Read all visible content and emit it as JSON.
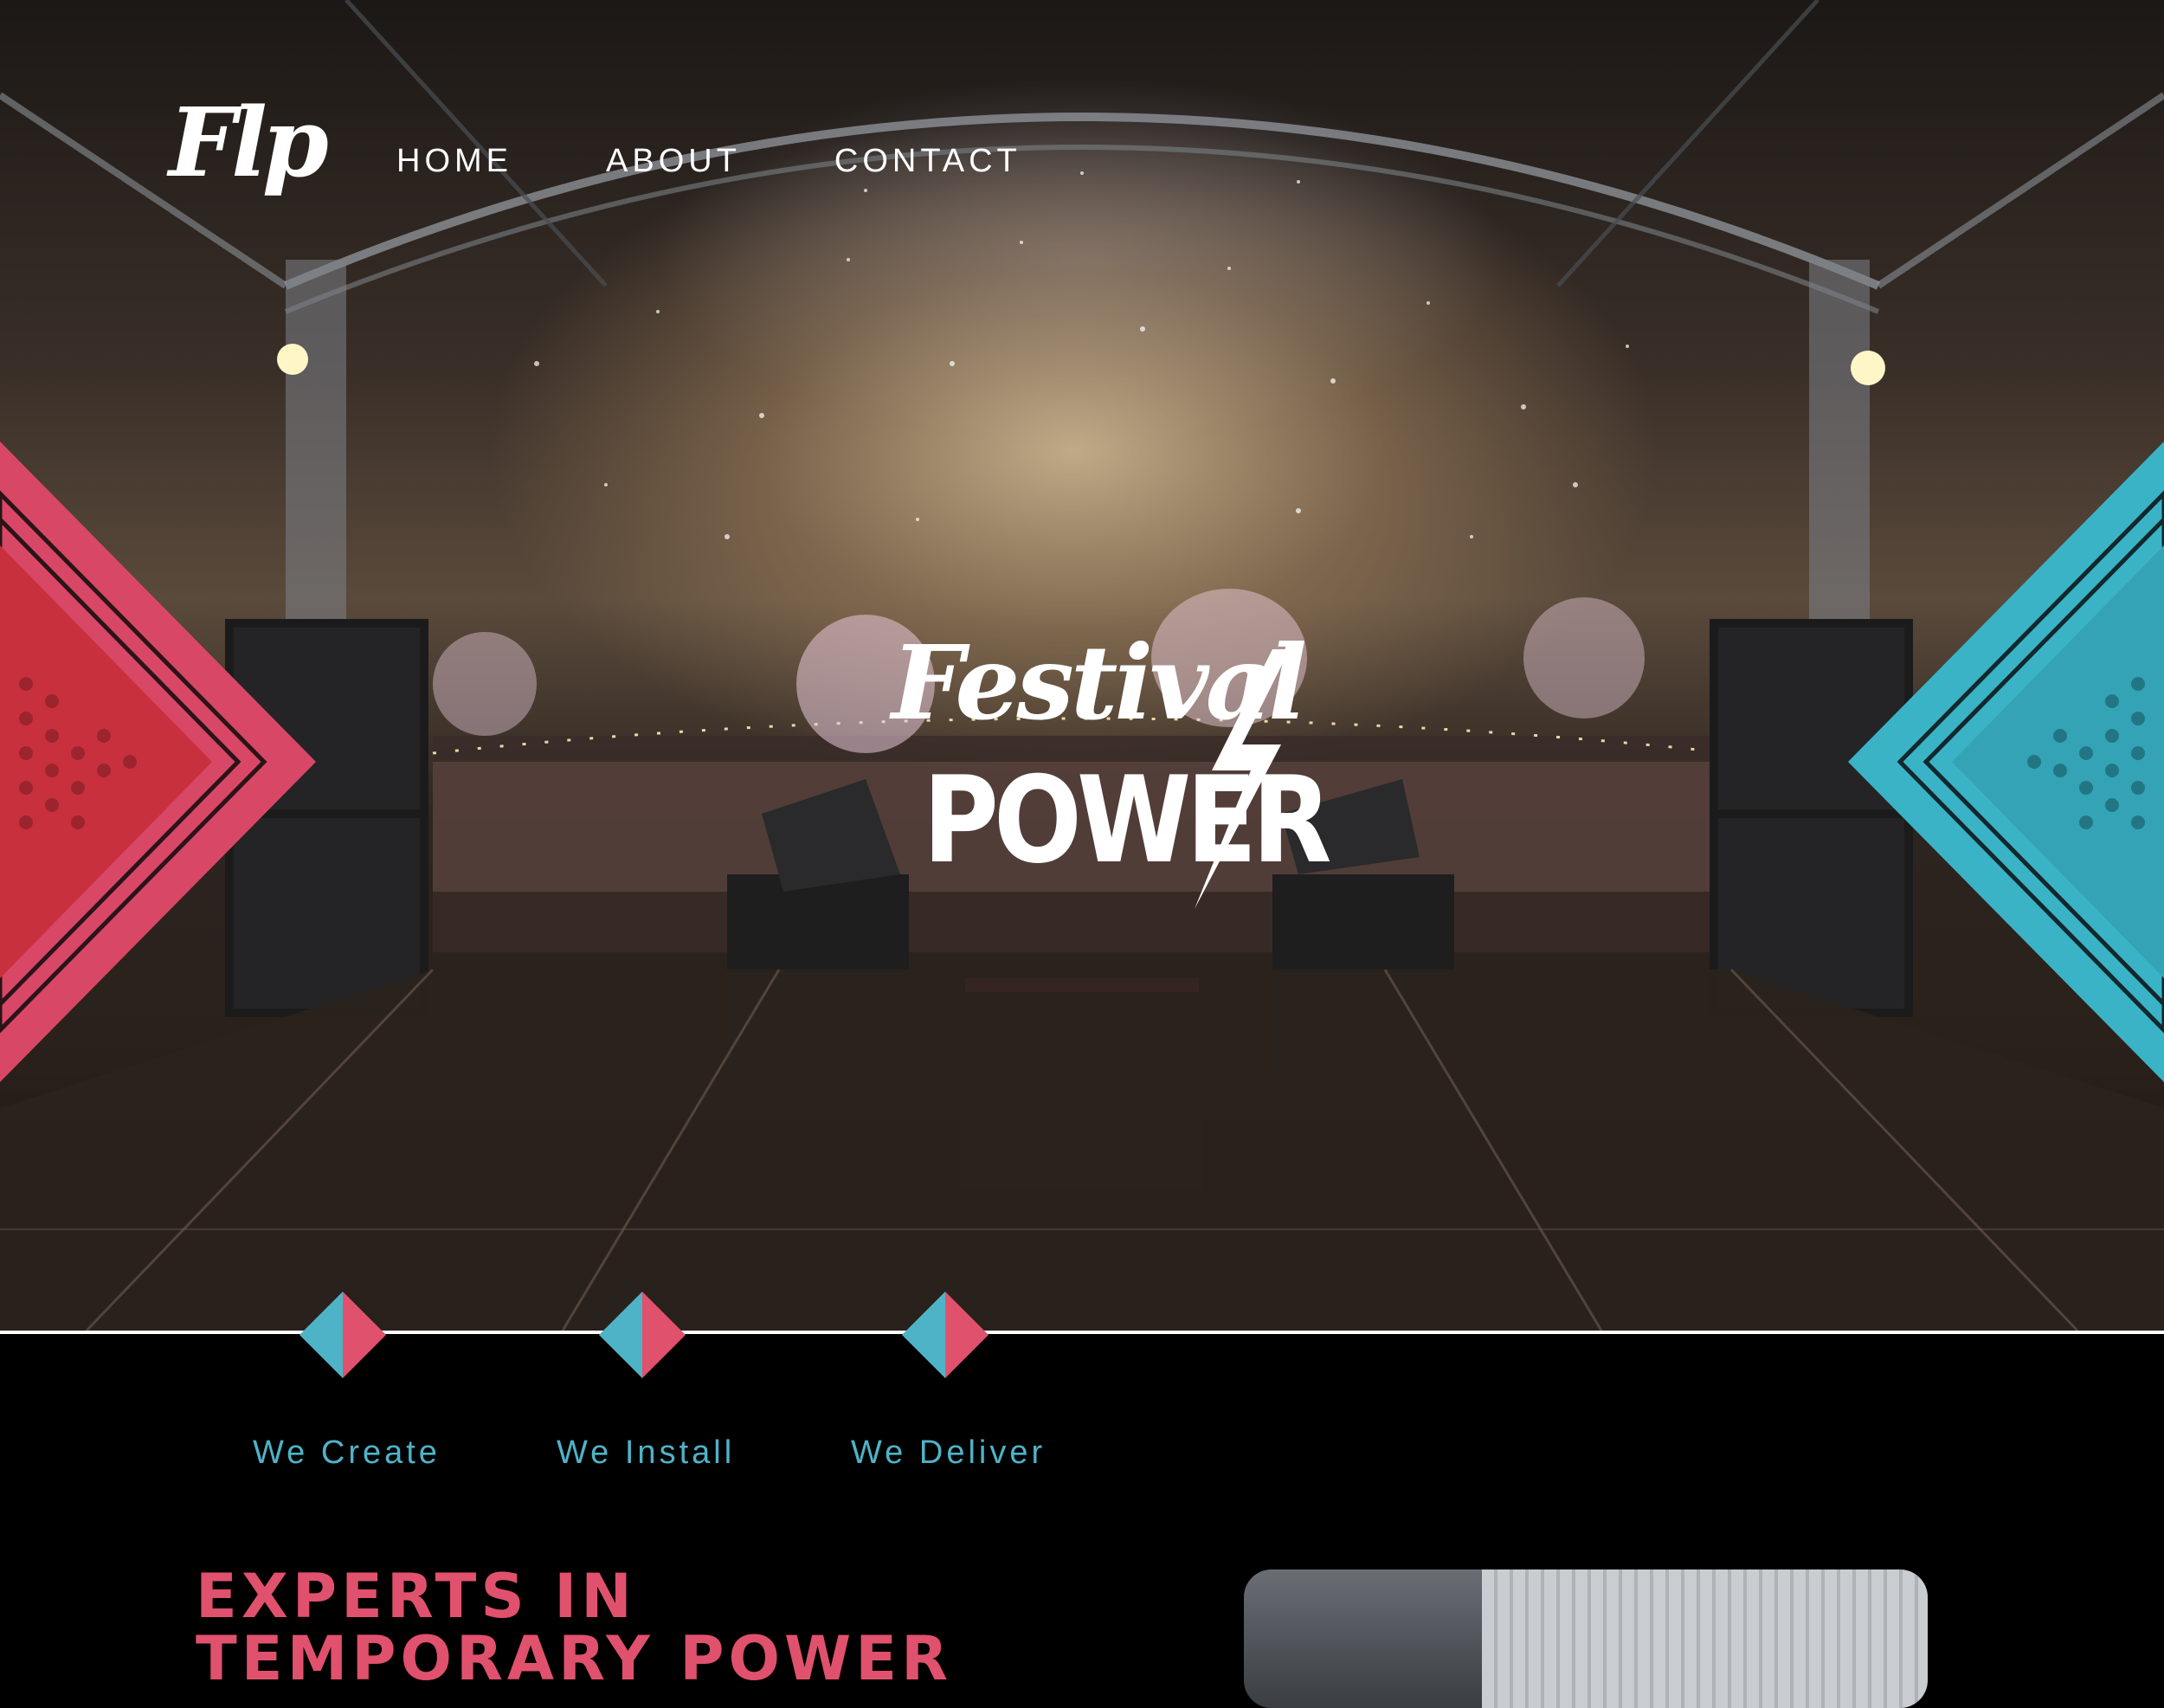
{
  "brand": {
    "logo_text": "Flp",
    "hero_logo_line1": "Festival",
    "hero_logo_line2": "POWER"
  },
  "nav": {
    "items": [
      {
        "label": "HOME"
      },
      {
        "label": "ABOUT"
      },
      {
        "label": "CONTACT"
      }
    ]
  },
  "services": [
    {
      "label": "We Create"
    },
    {
      "label": "We Install"
    },
    {
      "label": "We Deliver"
    }
  ],
  "headline": {
    "line1": "EXPERTS IN",
    "line2": "TEMPORARY POWER"
  },
  "colors": {
    "accent_pink": "#e0516d",
    "accent_cyan": "#4fb3c8",
    "background": "#000000"
  },
  "icons": [
    "lightning-bolt-icon",
    "diamond-icon"
  ]
}
